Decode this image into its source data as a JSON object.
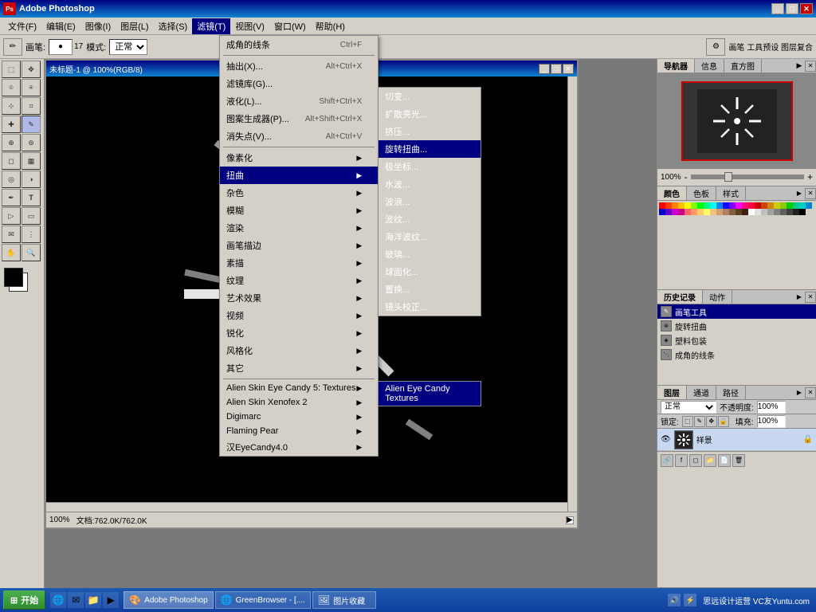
{
  "app": {
    "title": "Adobe Photoshop",
    "icon": "PS"
  },
  "titlebar": {
    "title": "Adobe Photoshop",
    "buttons": [
      "minimize",
      "maximize",
      "close"
    ]
  },
  "menubar": {
    "items": [
      {
        "id": "file",
        "label": "文件(F)"
      },
      {
        "id": "edit",
        "label": "编辑(E)"
      },
      {
        "id": "image",
        "label": "图像(I)"
      },
      {
        "id": "layer",
        "label": "图层(L)"
      },
      {
        "id": "select",
        "label": "选择(S)"
      },
      {
        "id": "filter",
        "label": "滤镜(T)",
        "active": true
      },
      {
        "id": "view",
        "label": "视图(V)"
      },
      {
        "id": "window",
        "label": "窗口(W)"
      },
      {
        "id": "help",
        "label": "帮助(H)"
      }
    ]
  },
  "toolbar": {
    "brush_label": "画笔:",
    "size": "17",
    "mode_label": "模式:",
    "mode_value": "正常"
  },
  "filter_menu": {
    "items": [
      {
        "label": "成角的线条",
        "shortcut": "Ctrl+F"
      },
      {
        "separator": true
      },
      {
        "label": "抽出(X)...",
        "shortcut": "Alt+Ctrl+X"
      },
      {
        "label": "滤镜库(G)..."
      },
      {
        "label": "液化(L)...",
        "shortcut": "Shift+Ctrl+X"
      },
      {
        "label": "图案生成器(P)...",
        "shortcut": "Alt+Shift+Ctrl+X"
      },
      {
        "label": "消失点(V)...",
        "shortcut": "Alt+Ctrl+V"
      },
      {
        "separator": true
      },
      {
        "label": "像素化",
        "hasArrow": true
      },
      {
        "label": "扭曲",
        "hasArrow": true,
        "active": true
      },
      {
        "label": "杂色",
        "hasArrow": true
      },
      {
        "label": "模糊",
        "hasArrow": true
      },
      {
        "label": "渲染",
        "hasArrow": true
      },
      {
        "label": "画笔描边",
        "hasArrow": true
      },
      {
        "label": "素描",
        "hasArrow": true
      },
      {
        "label": "纹理",
        "hasArrow": true
      },
      {
        "label": "艺术效果",
        "hasArrow": true
      },
      {
        "label": "视频",
        "hasArrow": true
      },
      {
        "label": "锐化",
        "hasArrow": true
      },
      {
        "label": "风格化",
        "hasArrow": true
      },
      {
        "label": "其它",
        "hasArrow": true
      },
      {
        "separator": true
      },
      {
        "label": "Alien Skin Eye Candy 5: Textures",
        "hasArrow": true
      },
      {
        "label": "Alien Skin Xenofex 2",
        "hasArrow": true
      },
      {
        "label": "Digimarc",
        "hasArrow": true
      },
      {
        "label": "Flaming Pear",
        "hasArrow": true
      },
      {
        "label": "汉EyeCandy4.0",
        "hasArrow": true
      }
    ]
  },
  "distort_submenu": {
    "items": [
      {
        "label": "切变...",
        "active": false
      },
      {
        "label": "扩散亮光...",
        "active": false
      },
      {
        "label": "挤压...",
        "active": false
      },
      {
        "label": "旋转扭曲...",
        "active": true
      },
      {
        "label": "极坐标...",
        "active": false
      },
      {
        "label": "水波...",
        "active": false
      },
      {
        "label": "波浪...",
        "active": false
      },
      {
        "label": "波纹...",
        "active": false
      },
      {
        "label": "海洋波纹...",
        "active": false
      },
      {
        "label": "玻璃...",
        "active": false
      },
      {
        "label": "球面化...",
        "active": false
      },
      {
        "label": "置换...",
        "active": false
      },
      {
        "label": "镜头校正...",
        "active": false
      }
    ]
  },
  "alien_submenu": {
    "items": [
      {
        "label": "Alien Eye Candy Textures"
      }
    ]
  },
  "document": {
    "title": "未标题-1 @ 100%(RGB/8)",
    "zoom": "100%",
    "status": "文档:762.0K/762.0K"
  },
  "navigator": {
    "tabs": [
      "导航器",
      "信息",
      "直方图"
    ],
    "zoom": "100%"
  },
  "color_panel": {
    "tabs": [
      "颜色",
      "色板",
      "样式"
    ]
  },
  "history_panel": {
    "tabs": [
      "历史记录",
      "动作"
    ],
    "items": [
      {
        "label": "画笔工具",
        "active": true
      },
      {
        "label": "旋转扭曲"
      },
      {
        "label": "塑料包装"
      },
      {
        "label": "成角的线条"
      }
    ]
  },
  "layers_panel": {
    "tabs": [
      "图层",
      "通道",
      "路径"
    ],
    "mode": "正常",
    "opacity": "100%",
    "fill": "100%",
    "locks": [
      "a",
      "b",
      "c",
      "d"
    ],
    "layer_label": "祥景"
  },
  "taskbar": {
    "start_label": "开始",
    "items": [
      {
        "label": "Adobe Photoshop",
        "active": true
      },
      {
        "label": "GreenBrowser - [...."
      },
      {
        "label": "图片收藏"
      }
    ],
    "clock": "思远设计运营 VC友Yuntu.com"
  },
  "colors": {
    "active_menu": "#000080",
    "titlebar_start": "#000080",
    "titlebar_end": "#1084d0",
    "taskbar_bg": "#1040a0",
    "highlight": "#000080"
  }
}
